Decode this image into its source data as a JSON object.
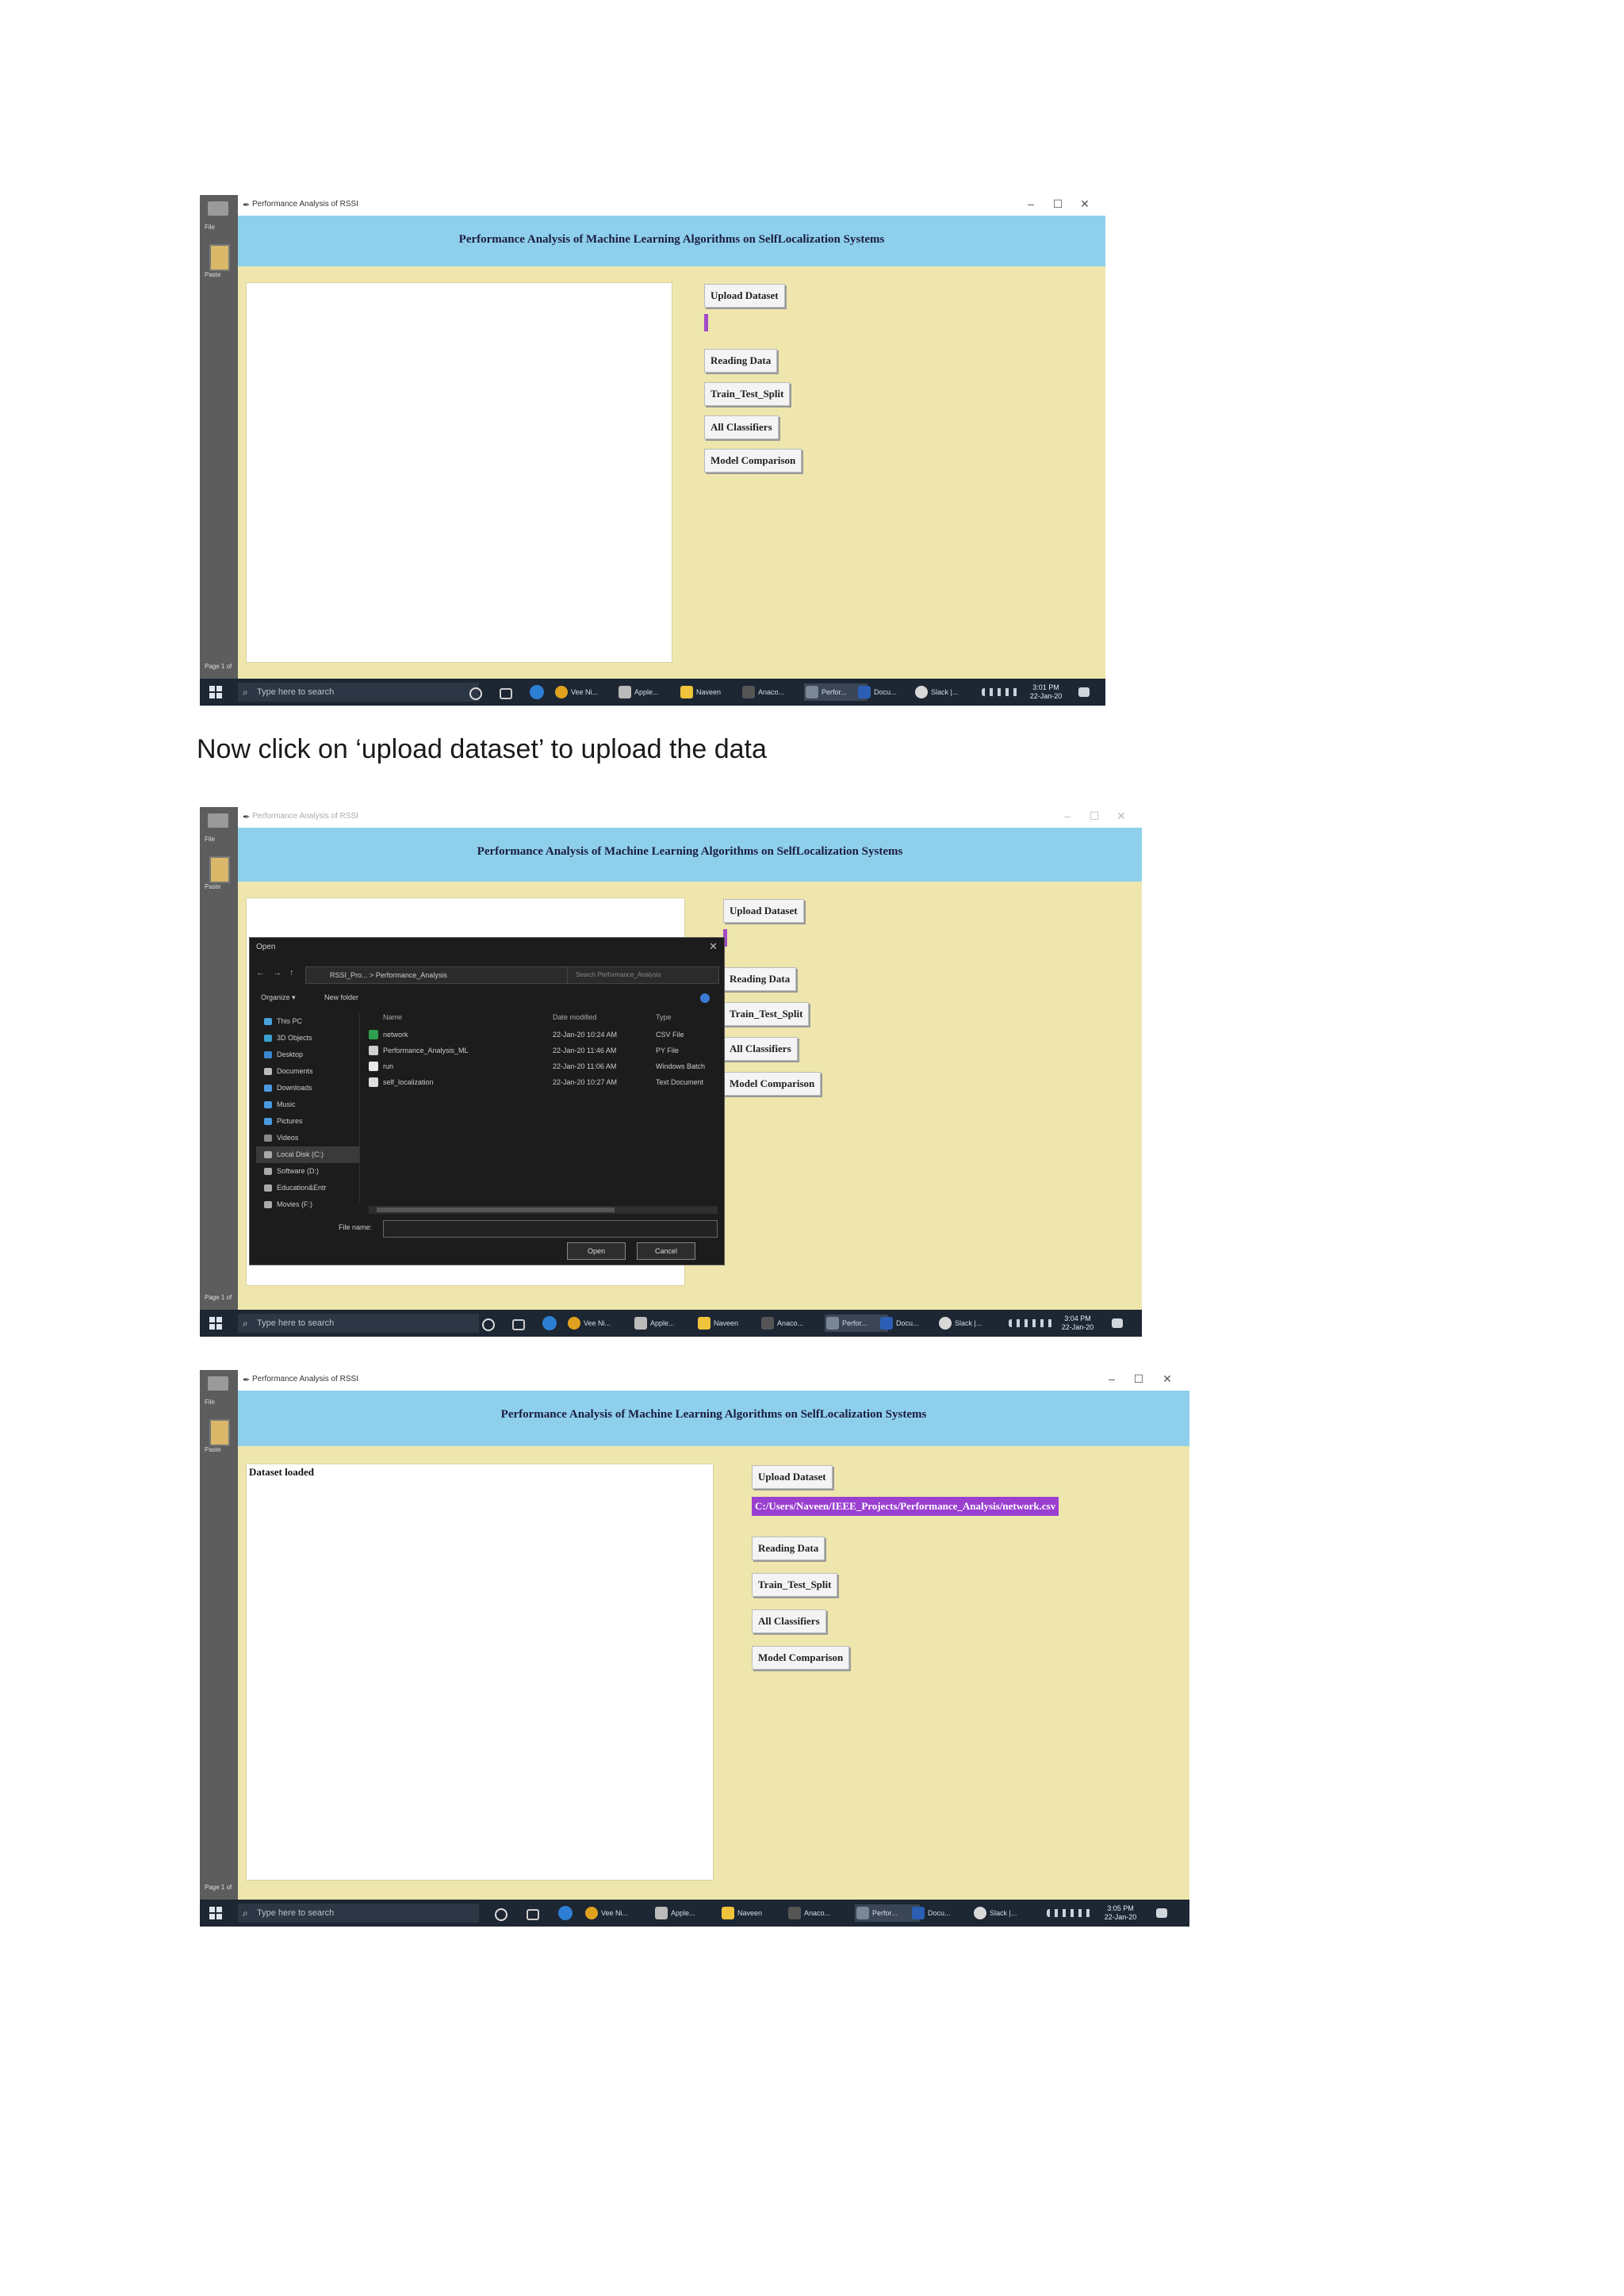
{
  "app": {
    "window_title": "Performance Analysis of RSSI",
    "heading": "Performance Analysis of Machine Learning Algorithms on SelfLocalization Systems",
    "buttons": {
      "upload": "Upload Dataset",
      "reading": "Reading Data",
      "split": "Train_Test_Split",
      "classifiers": "All Classifiers",
      "comparison": "Model Comparison"
    },
    "status_loaded": "Dataset loaded",
    "dataset_path": "C:/Users/Naveen/IEEE_Projects/Performance_Analysis/network.csv",
    "colors": {
      "banner": "#8ed0ec",
      "body": "#eee6ad",
      "path_highlight": "#9a3fd0"
    }
  },
  "word": {
    "file_label": "File",
    "paste_label": "Paste",
    "page_label": "Page 1 of"
  },
  "caption": "Now click on ‘upload dataset’ to upload the data",
  "taskbar": {
    "search_placeholder": "Type here to search",
    "apps": [
      "Vee Ni...",
      "Apple...",
      "Naveen",
      "Anaco...",
      "Perfor...",
      "Docu...",
      "Slack |..."
    ],
    "clock1": {
      "time": "3:01 PM",
      "date": "22-Jan-20"
    },
    "clock2": {
      "time": "3:04 PM",
      "date": "22-Jan-20"
    },
    "clock3": {
      "time": "3:05 PM",
      "date": "22-Jan-20"
    }
  },
  "dialog": {
    "title": "Open",
    "address": "RSSI_Pro... > Performance_Analysis",
    "search_placeholder": "Search Performance_Analysis",
    "organize": "Organize ▾",
    "new_folder": "New folder",
    "sidebar": [
      "This PC",
      "3D Objects",
      "Desktop",
      "Documents",
      "Downloads",
      "Music",
      "Pictures",
      "Videos",
      "Local Disk (C:)",
      "Software (D:)",
      "Education&Entr",
      "Movies (F:)"
    ],
    "columns": {
      "name": "Name",
      "date": "Date modified",
      "type": "Type"
    },
    "files": [
      {
        "name": "network",
        "date": "22-Jan-20 10:24 AM",
        "type": "CSV File"
      },
      {
        "name": "Performance_Analysis_ML",
        "date": "22-Jan-20 11:46 AM",
        "type": "PY File"
      },
      {
        "name": "run",
        "date": "22-Jan-20 11:06 AM",
        "type": "Windows Batch"
      },
      {
        "name": "self_localization",
        "date": "22-Jan-20 10:27 AM",
        "type": "Text Document"
      }
    ],
    "filename_label": "File name:",
    "open": "Open",
    "cancel": "Cancel"
  }
}
